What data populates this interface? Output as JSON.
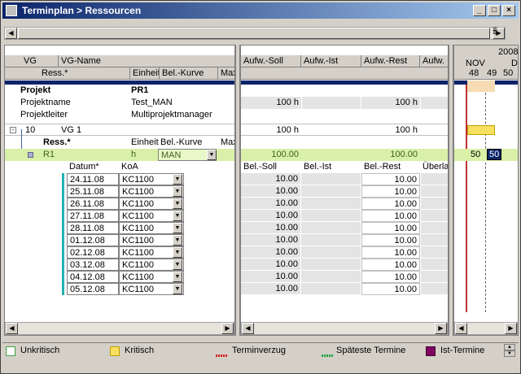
{
  "window": {
    "title": "Terminplan > Ressourcen"
  },
  "colors": {
    "accent": "#0a246a",
    "critical": "#f8e060",
    "green_row": "#d8f0a8",
    "unkritisch": "#ffffff",
    "istTermine": "#800060"
  },
  "left_header": {
    "row1": [
      "VG",
      "VG-Name"
    ],
    "row2": [
      "Ress.*",
      "Einheit",
      "Bel.-Kurve",
      "Max"
    ]
  },
  "mid_header": [
    "Aufw.-Soll",
    "Aufw.-Ist",
    "Aufw.-Rest",
    "Aufw."
  ],
  "timeline": {
    "year": "2008",
    "month": "NOV",
    "month2": "D",
    "weeks": [
      "48",
      "49",
      "50"
    ]
  },
  "project": {
    "label": "Projekt",
    "value": "PR1",
    "name_label": "Projektname",
    "name_value": "Test_MAN",
    "leader_label": "Projektleiter",
    "leader_value": "Multiprojektmanager",
    "soll": "100 h",
    "rest": "100 h"
  },
  "vg": {
    "num": "10",
    "name": "VG 1",
    "soll": "100 h",
    "rest": "100 h"
  },
  "res_header": [
    "Ress.*",
    "Einheit",
    "Bel.-Kurve",
    "Max"
  ],
  "resource": {
    "name": "R1",
    "unit": "h",
    "curve": "MAN",
    "soll": "100.00",
    "rest": "100.00",
    "w49": "50",
    "w50": "50"
  },
  "detail_header": {
    "left": [
      "Datum*",
      "KoA"
    ],
    "mid": [
      "Bel.-Soll",
      "Bel.-Ist",
      "Bel.-Rest",
      "Überla"
    ]
  },
  "detail_rows": [
    {
      "date": "24.11.08",
      "koa": "KC1100",
      "soll": "10.00",
      "rest": "10.00"
    },
    {
      "date": "25.11.08",
      "koa": "KC1100",
      "soll": "10.00",
      "rest": "10.00"
    },
    {
      "date": "26.11.08",
      "koa": "KC1100",
      "soll": "10.00",
      "rest": "10.00"
    },
    {
      "date": "27.11.08",
      "koa": "KC1100",
      "soll": "10.00",
      "rest": "10.00"
    },
    {
      "date": "28.11.08",
      "koa": "KC1100",
      "soll": "10.00",
      "rest": "10.00"
    },
    {
      "date": "01.12.08",
      "koa": "KC1100",
      "soll": "10.00",
      "rest": "10.00"
    },
    {
      "date": "02.12.08",
      "koa": "KC1100",
      "soll": "10.00",
      "rest": "10.00"
    },
    {
      "date": "03.12.08",
      "koa": "KC1100",
      "soll": "10.00",
      "rest": "10.00"
    },
    {
      "date": "04.12.08",
      "koa": "KC1100",
      "soll": "10.00",
      "rest": "10.00"
    },
    {
      "date": "05.12.08",
      "koa": "KC1100",
      "soll": "10.00",
      "rest": "10.00"
    }
  ],
  "legend": [
    "Unkritisch",
    "Kritisch",
    "Terminverzug",
    "Späteste Termine",
    "Ist-Termine"
  ]
}
